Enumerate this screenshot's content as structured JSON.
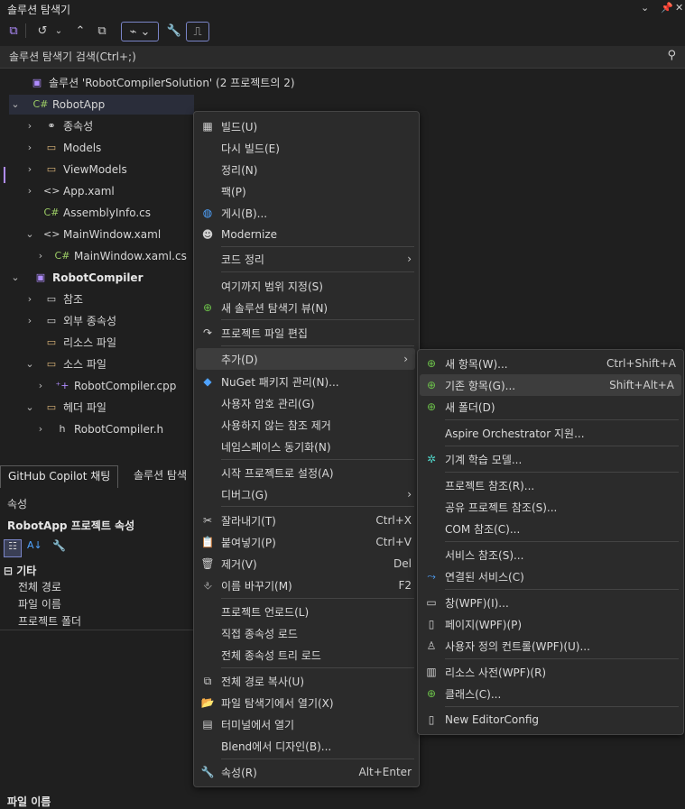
{
  "titlebar": {
    "title": "솔루션 탐색기"
  },
  "search": {
    "placeholder": "솔루션 탐색기 검색(Ctrl+;)"
  },
  "tree": {
    "solution": "솔루션 'RobotCompilerSolution' (2 프로젝트의 2)",
    "items": [
      {
        "label": "RobotApp",
        "icon": "csharp-project-icon"
      },
      {
        "label": "종속성",
        "icon": "dependencies-icon"
      },
      {
        "label": "Models",
        "icon": "folder-icon"
      },
      {
        "label": "ViewModels",
        "icon": "folder-icon"
      },
      {
        "label": "App.xaml",
        "icon": "xaml-file-icon"
      },
      {
        "label": "AssemblyInfo.cs",
        "icon": "csharp-file-icon"
      },
      {
        "label": "MainWindow.xaml",
        "icon": "xaml-file-icon"
      },
      {
        "label": "MainWindow.xaml.cs",
        "icon": "csharp-file-icon"
      },
      {
        "label": "RobotCompiler",
        "icon": "cpp-project-icon"
      },
      {
        "label": "참조",
        "icon": "references-icon"
      },
      {
        "label": "외부 종속성",
        "icon": "folder-icon"
      },
      {
        "label": "리소스 파일",
        "icon": "folder-icon"
      },
      {
        "label": "소스 파일",
        "icon": "folder-icon"
      },
      {
        "label": "RobotCompiler.cpp",
        "icon": "cpp-file-icon"
      },
      {
        "label": "헤더 파일",
        "icon": "folder-icon"
      },
      {
        "label": "RobotCompiler.h",
        "icon": "header-file-icon"
      }
    ]
  },
  "tabs": {
    "copilot": "GitHub Copilot 채팅",
    "solution": "솔루션 탐색"
  },
  "properties": {
    "header": "속성",
    "title": "RobotApp 프로젝트 속성",
    "category": "기타",
    "rows": [
      "전체 경로",
      "파일 이름",
      "프로젝트 폴더"
    ],
    "footer": "파일 이름"
  },
  "context_menu": {
    "items": [
      {
        "label": "빌드(U)",
        "shortcut": "",
        "icon": "build-icon"
      },
      {
        "label": "다시 빌드(E)",
        "shortcut": "",
        "icon": ""
      },
      {
        "label": "정리(N)",
        "shortcut": "",
        "icon": ""
      },
      {
        "label": "팩(P)",
        "shortcut": "",
        "icon": ""
      },
      {
        "label": "게시(B)...",
        "shortcut": "",
        "icon": "globe-icon"
      },
      {
        "label": "Modernize",
        "shortcut": "",
        "icon": "copilot-icon"
      },
      {
        "label": "코드 정리",
        "shortcut": "",
        "icon": "",
        "submenu": true
      },
      {
        "label": "여기까지 범위 지정(S)",
        "shortcut": "",
        "icon": ""
      },
      {
        "label": "새 솔루션 탐색기 뷰(N)",
        "shortcut": "",
        "icon": "new-view-icon"
      },
      {
        "label": "프로젝트 파일 편집",
        "shortcut": "",
        "icon": "arrow-icon"
      },
      {
        "label": "추가(D)",
        "shortcut": "",
        "icon": "",
        "submenu": true
      },
      {
        "label": "NuGet 패키지 관리(N)...",
        "shortcut": "",
        "icon": "nuget-icon"
      },
      {
        "label": "사용자 암호 관리(G)",
        "shortcut": "",
        "icon": ""
      },
      {
        "label": "사용하지 않는 참조 제거",
        "shortcut": "",
        "icon": ""
      },
      {
        "label": "네임스페이스 동기화(N)",
        "shortcut": "",
        "icon": ""
      },
      {
        "label": "시작 프로젝트로 설정(A)",
        "shortcut": "",
        "icon": ""
      },
      {
        "label": "디버그(G)",
        "shortcut": "",
        "icon": "",
        "submenu": true
      },
      {
        "label": "잘라내기(T)",
        "shortcut": "Ctrl+X",
        "icon": "scissors-icon"
      },
      {
        "label": "붙여넣기(P)",
        "shortcut": "Ctrl+V",
        "icon": "paste-icon"
      },
      {
        "label": "제거(V)",
        "shortcut": "Del",
        "icon": "trash-icon"
      },
      {
        "label": "이름 바꾸기(M)",
        "shortcut": "F2",
        "icon": "rename-icon"
      },
      {
        "label": "프로젝트 언로드(L)",
        "shortcut": "",
        "icon": ""
      },
      {
        "label": "직접 종속성 로드",
        "shortcut": "",
        "icon": ""
      },
      {
        "label": "전체 종속성 트리 로드",
        "shortcut": "",
        "icon": ""
      },
      {
        "label": "전체 경로 복사(U)",
        "shortcut": "",
        "icon": "copy-icon"
      },
      {
        "label": "파일 탐색기에서 열기(X)",
        "shortcut": "",
        "icon": "folder-open-icon"
      },
      {
        "label": "터미널에서 열기",
        "shortcut": "",
        "icon": "terminal-icon"
      },
      {
        "label": "Blend에서 디자인(B)...",
        "shortcut": "",
        "icon": ""
      },
      {
        "label": "속성(R)",
        "shortcut": "Alt+Enter",
        "icon": "wrench-icon"
      }
    ]
  },
  "submenu": {
    "items": [
      {
        "label": "새 항목(W)...",
        "shortcut": "Ctrl+Shift+A",
        "icon": "new-item-icon"
      },
      {
        "label": "기존 항목(G)...",
        "shortcut": "Shift+Alt+A",
        "icon": "existing-item-icon"
      },
      {
        "label": "새 폴더(D)",
        "shortcut": "",
        "icon": "new-folder-icon"
      },
      {
        "label": "Aspire Orchestrator 지원...",
        "shortcut": "",
        "icon": ""
      },
      {
        "label": "기계 학습 모델...",
        "shortcut": "",
        "icon": "ml-icon"
      },
      {
        "label": "프로젝트 참조(R)...",
        "shortcut": "",
        "icon": ""
      },
      {
        "label": "공유 프로젝트 참조(S)...",
        "shortcut": "",
        "icon": ""
      },
      {
        "label": "COM 참조(C)...",
        "shortcut": "",
        "icon": ""
      },
      {
        "label": "서비스 참조(S)...",
        "shortcut": "",
        "icon": ""
      },
      {
        "label": "연결된 서비스(C)",
        "shortcut": "",
        "icon": "connected-service-icon"
      },
      {
        "label": "창(WPF)(I)...",
        "shortcut": "",
        "icon": "window-icon"
      },
      {
        "label": "페이지(WPF)(P)",
        "shortcut": "",
        "icon": "page-icon"
      },
      {
        "label": "사용자 정의 컨트롤(WPF)(U)...",
        "shortcut": "",
        "icon": "user-control-icon"
      },
      {
        "label": "리소스 사전(WPF)(R)",
        "shortcut": "",
        "icon": "dictionary-icon"
      },
      {
        "label": "클래스(C)...",
        "shortcut": "",
        "icon": "class-icon"
      },
      {
        "label": "New EditorConfig",
        "shortcut": "",
        "icon": "editorconfig-icon"
      }
    ]
  }
}
